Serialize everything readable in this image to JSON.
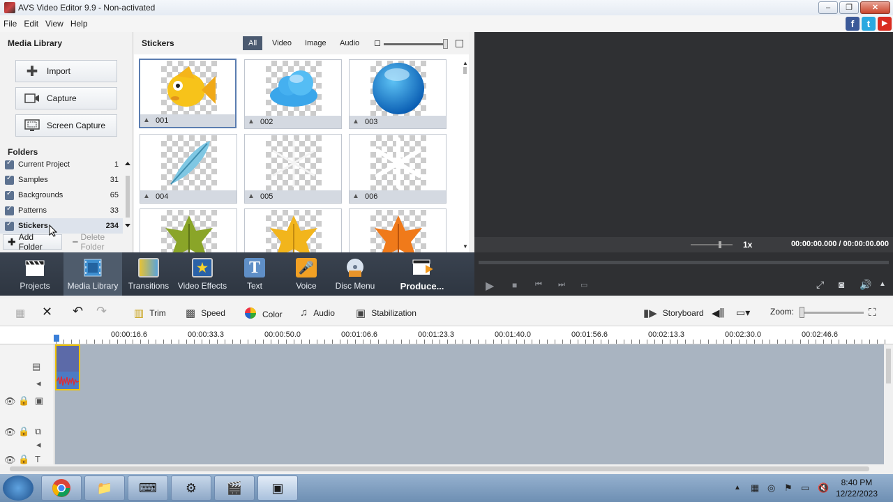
{
  "window": {
    "title": "AVS Video Editor 9.9 - Non-activated",
    "min": "–",
    "max": "❐",
    "close": "✕"
  },
  "menu": [
    "File",
    "Edit",
    "View",
    "Help"
  ],
  "social": {
    "facebook": "f",
    "twitter": "t",
    "youtube": "▶"
  },
  "media_library": {
    "title": "Media Library",
    "buttons": {
      "import": "Import",
      "capture": "Capture",
      "screen_capture": "Screen Capture"
    }
  },
  "folders": {
    "title": "Folders",
    "items": [
      {
        "name": "Current Project",
        "count": "1"
      },
      {
        "name": "Samples",
        "count": "31"
      },
      {
        "name": "Backgrounds",
        "count": "65"
      },
      {
        "name": "Patterns",
        "count": "33"
      },
      {
        "name": "Stickers",
        "count": "234",
        "selected": true
      }
    ],
    "add_folder": "Add Folder",
    "delete_folder": "Delete Folder"
  },
  "stickers": {
    "title": "Stickers",
    "filters": [
      "All",
      "Video",
      "Image",
      "Audio"
    ],
    "active_filter": "All",
    "items": [
      {
        "label": "001",
        "icon": "fish"
      },
      {
        "label": "002",
        "icon": "cloud"
      },
      {
        "label": "003",
        "icon": "blue-ball"
      },
      {
        "label": "004",
        "icon": "feather"
      },
      {
        "label": "005",
        "icon": "snowflake-faint"
      },
      {
        "label": "006",
        "icon": "snowflake"
      },
      {
        "label": "",
        "icon": "green-leaf"
      },
      {
        "label": "",
        "icon": "yellow-leaf"
      },
      {
        "label": "",
        "icon": "orange-leaf"
      }
    ]
  },
  "preview": {
    "speed": "1x",
    "timecode": "00:00:00.000  /  00:00:00.000"
  },
  "toolbar": {
    "items": [
      {
        "label": "Projects",
        "icon": "clapper-icon"
      },
      {
        "label": "Media Library",
        "icon": "film-icon",
        "active": true
      },
      {
        "label": "Transitions",
        "icon": "transitions-icon"
      },
      {
        "label": "Video Effects",
        "icon": "star-icon"
      },
      {
        "label": "Text",
        "icon": "text-icon"
      },
      {
        "label": "Voice",
        "icon": "mic-icon"
      },
      {
        "label": "Disc Menu",
        "icon": "disc-icon"
      },
      {
        "label": "Produce...",
        "icon": "produce-icon"
      }
    ]
  },
  "timeline_tools": {
    "trim": "Trim",
    "speed": "Speed",
    "color": "Color",
    "audio": "Audio",
    "stabilization": "Stabilization",
    "storyboard": "Storyboard",
    "zoom": "Zoom:"
  },
  "ruler": [
    "00:00:16.6",
    "00:00:33.3",
    "00:00:50.0",
    "00:01:06.6",
    "00:01:23.3",
    "00:01:40.0",
    "00:01:56.6",
    "00:02:13.3",
    "00:02:30.0",
    "00:02:46.6"
  ],
  "taskbar": {
    "time": "8:40 PM",
    "date": "12/22/2023"
  },
  "colors": {
    "toolbar_bg": "#333b47",
    "accent": "#4b5a70",
    "timeline_bg": "#a9b4c1",
    "clip_border": "#f0c400"
  }
}
